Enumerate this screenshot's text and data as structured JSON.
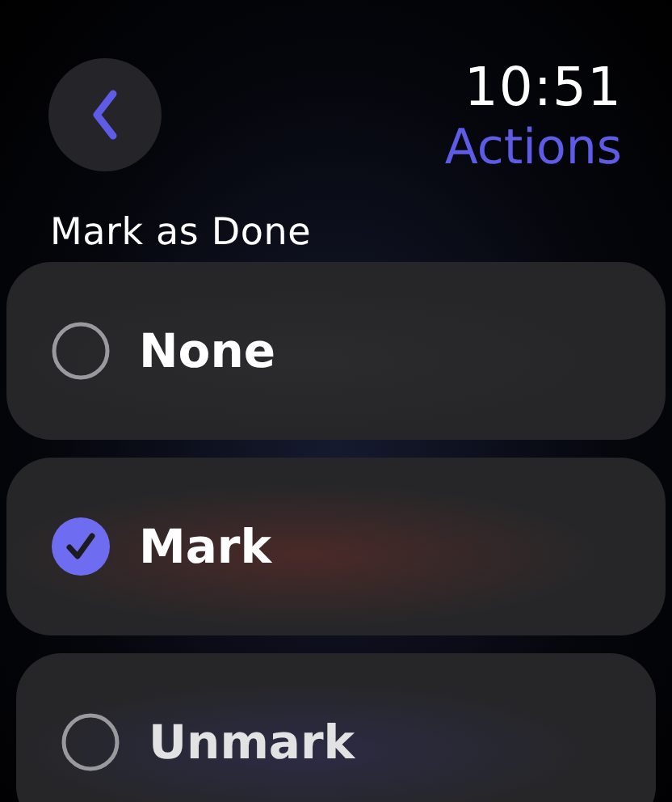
{
  "status_bar": {
    "time": "10:51"
  },
  "nav": {
    "title": "Actions"
  },
  "section": {
    "title": "Mark as Done"
  },
  "options": [
    {
      "label": "None",
      "selected": false
    },
    {
      "label": "Mark",
      "selected": true
    },
    {
      "label": "Unmark",
      "selected": false
    }
  ]
}
